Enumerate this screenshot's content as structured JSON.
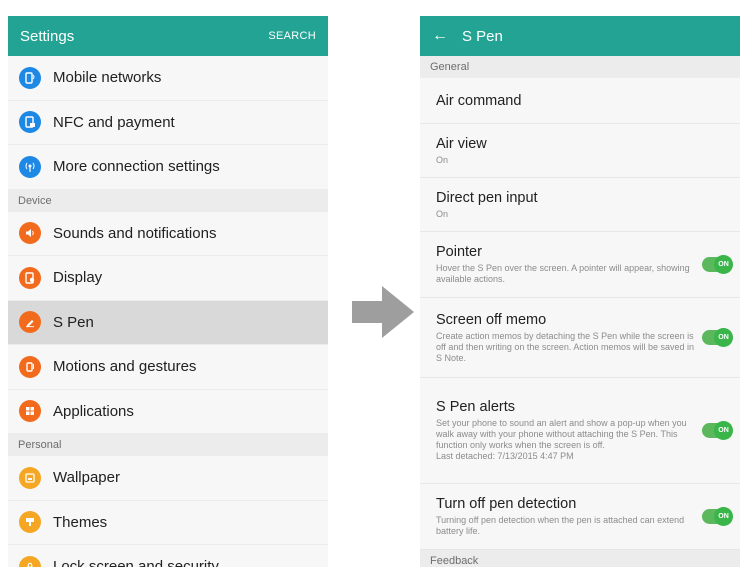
{
  "left": {
    "title": "Settings",
    "action": "SEARCH",
    "rows_top": [
      {
        "label": "Mobile networks",
        "icon": "mobile-networks-icon",
        "color": "blue"
      },
      {
        "label": "NFC and payment",
        "icon": "nfc-icon",
        "color": "blue"
      },
      {
        "label": "More connection settings",
        "icon": "more-connections-icon",
        "color": "blue"
      }
    ],
    "device_header": "Device",
    "rows_device": [
      {
        "label": "Sounds and notifications",
        "icon": "sound-icon",
        "color": "orange"
      },
      {
        "label": "Display",
        "icon": "display-icon",
        "color": "orange"
      },
      {
        "label": "S Pen",
        "icon": "s-pen-icon",
        "color": "orange",
        "selected": true
      },
      {
        "label": "Motions and gestures",
        "icon": "motions-icon",
        "color": "orange"
      },
      {
        "label": "Applications",
        "icon": "applications-icon",
        "color": "orange"
      }
    ],
    "personal_header": "Personal",
    "rows_personal": [
      {
        "label": "Wallpaper",
        "icon": "wallpaper-icon",
        "color": "amber"
      },
      {
        "label": "Themes",
        "icon": "themes-icon",
        "color": "amber"
      },
      {
        "label": "Lock screen and security",
        "icon": "lock-icon",
        "color": "amber"
      }
    ]
  },
  "right": {
    "back": "←",
    "title": "S Pen",
    "general_header": "General",
    "settings": [
      {
        "title": "Air command",
        "sub": ""
      },
      {
        "title": "Air view",
        "sub": "On"
      },
      {
        "title": "Direct pen input",
        "sub": "On"
      },
      {
        "title": "Pointer",
        "sub": "Hover the S Pen over the screen. A pointer will appear, showing available actions.",
        "toggle": "ON"
      },
      {
        "title": "Screen off memo",
        "sub": "Create action memos by detaching the S Pen while the screen is off and then writing on the screen. Action memos will be saved in S Note.",
        "toggle": "ON"
      },
      {
        "title": "S Pen alerts",
        "sub": "Set your phone to sound an alert and show a pop-up when you walk away with your phone without attaching the S Pen. This function only works when the screen is off.",
        "sub2": "Last detached: 7/13/2015 4:47 PM",
        "toggle": "ON"
      },
      {
        "title": "Turn off pen detection",
        "sub": "Turning off pen detection when the pen is attached can extend battery life.",
        "toggle": "ON"
      }
    ],
    "feedback_header": "Feedback"
  },
  "colors": {
    "appbar": "#23a394",
    "blue": "#1e88e5",
    "orange": "#f26b1d",
    "amber": "#f5a623",
    "toggle": "#39b54a",
    "arrow": "#9e9e9e"
  }
}
